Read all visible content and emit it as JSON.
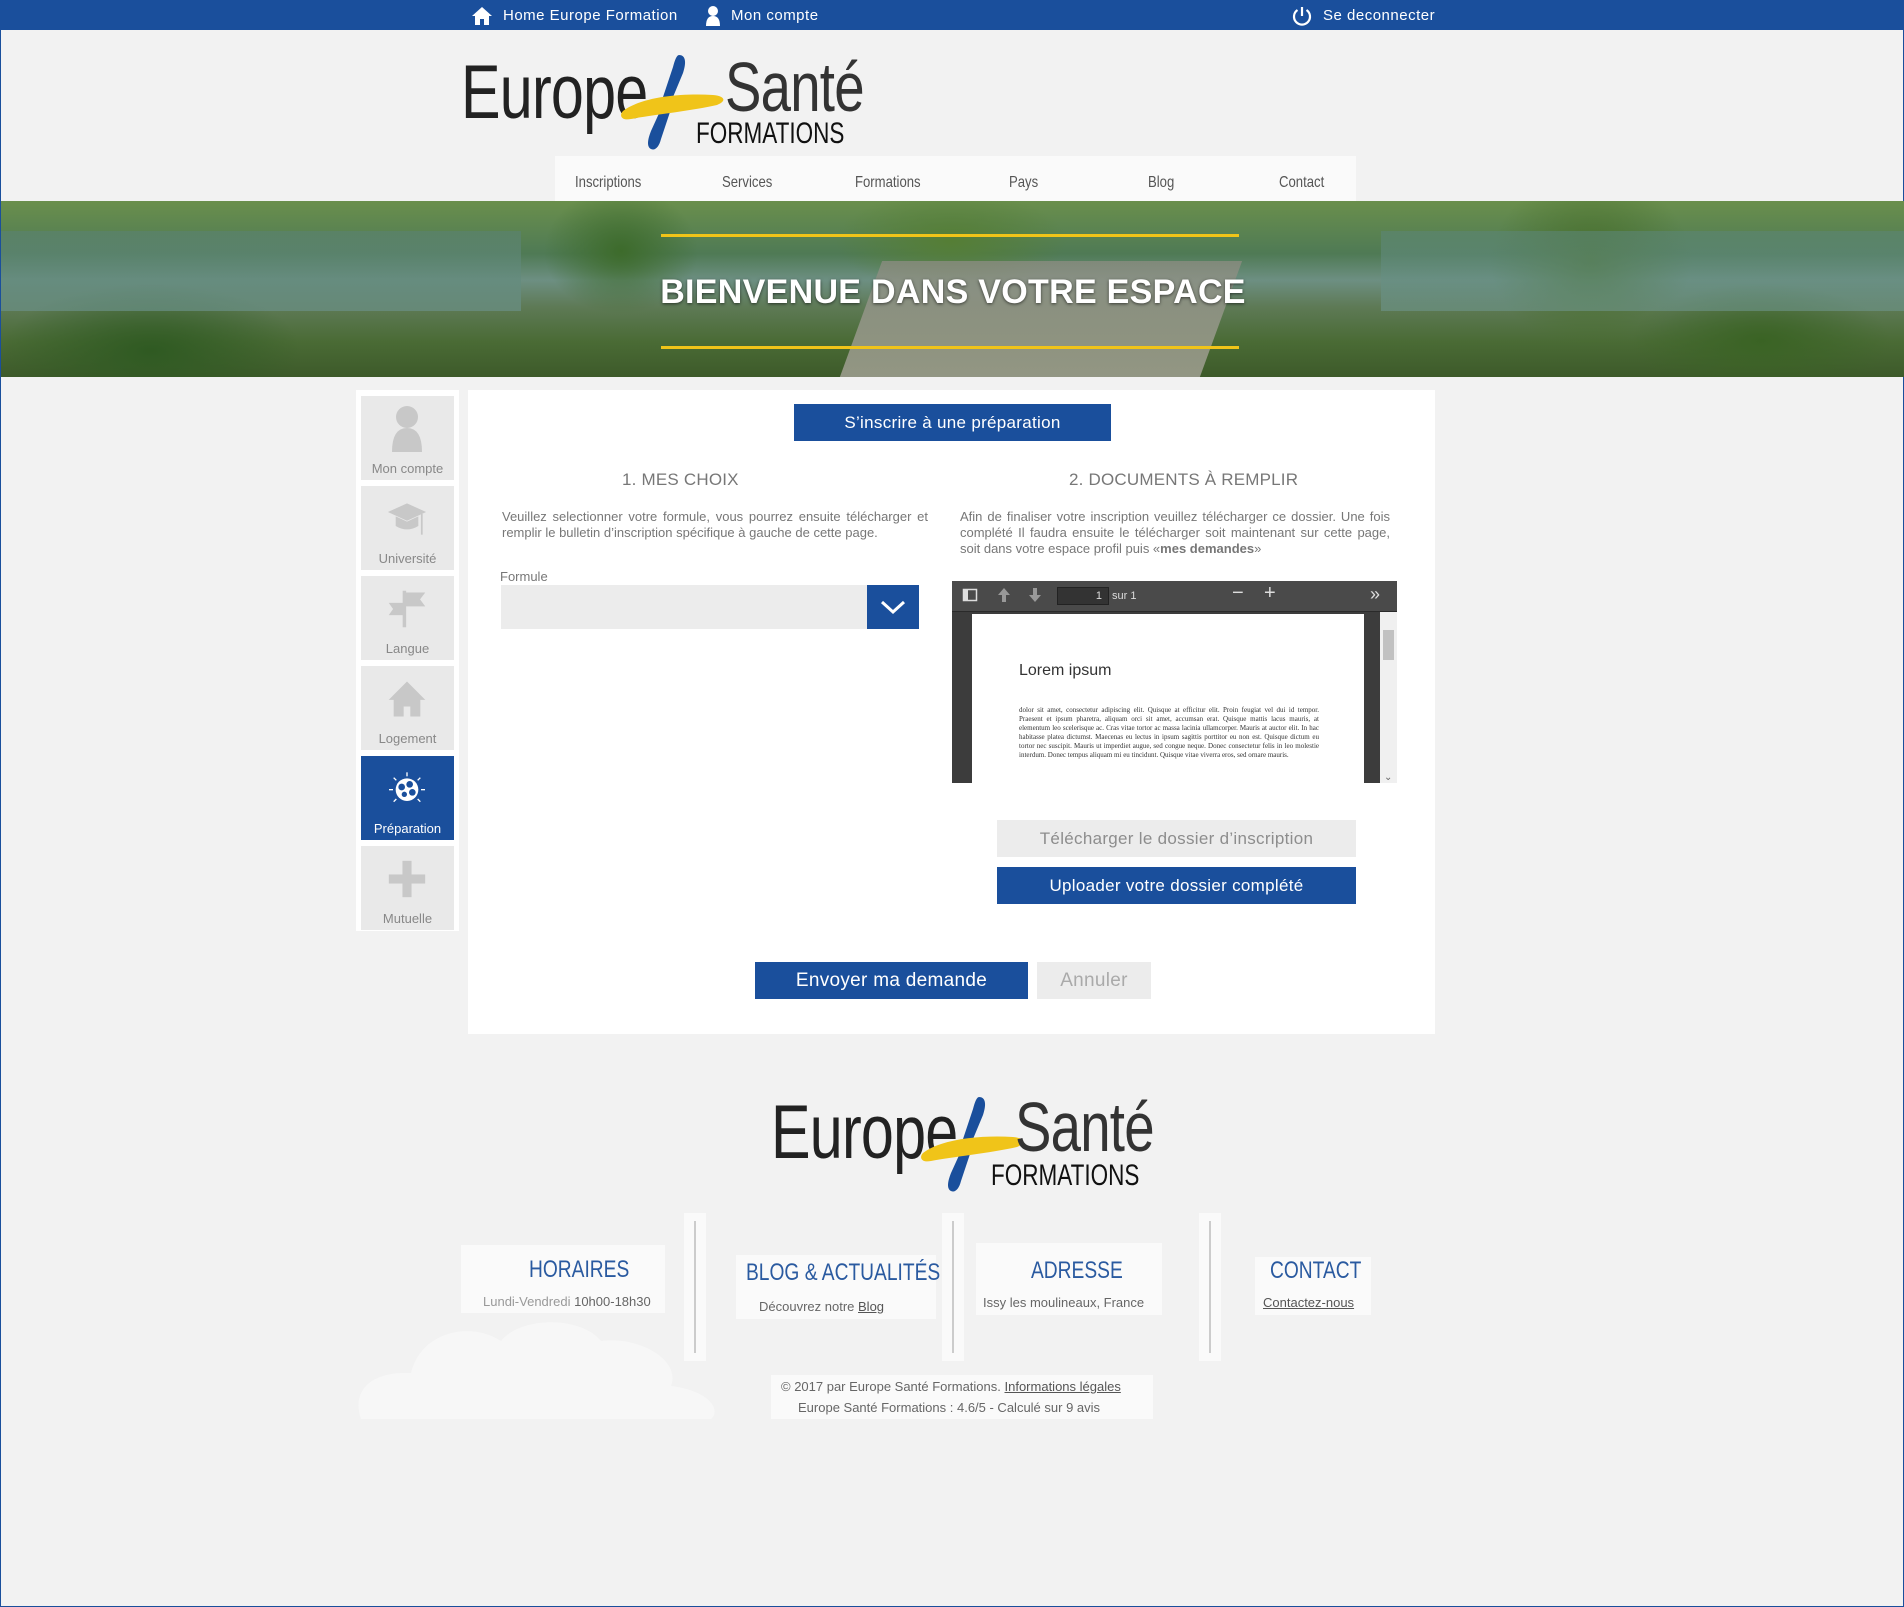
{
  "topbar": {
    "home_label": "Home Europe Formation",
    "account_label": "Mon compte",
    "logout_label": "Se deconnecter"
  },
  "logo": {
    "word1": "Europe",
    "word2": "Santé",
    "word3": "FORMATIONS"
  },
  "nav": {
    "items": [
      "Inscriptions",
      "Services",
      "Formations",
      "Pays",
      "Blog",
      "Contact"
    ]
  },
  "hero": {
    "title": "BIENVENUE DANS VOTRE ESPACE"
  },
  "sidebar": {
    "items": [
      {
        "label": "Mon compte",
        "icon": "user-icon"
      },
      {
        "label": "Université",
        "icon": "graduation-cap-icon"
      },
      {
        "label": "Langue",
        "icon": "flags-icon"
      },
      {
        "label": "Logement",
        "icon": "house-icon"
      },
      {
        "label": "Préparation",
        "icon": "brain-icon"
      },
      {
        "label": "Mutuelle",
        "icon": "plus-icon"
      }
    ],
    "active_label": "Préparation"
  },
  "main": {
    "header_button": "S’inscrire à une préparation",
    "choices": {
      "title": "1. MES CHOIX",
      "text": "Veuillez selectionner votre formule, vous pourrez ensuite télécharger et remplir le bulletin d’inscription spécifique à gauche de cette page.",
      "formule_label": "Formule",
      "formule_value": ""
    },
    "documents": {
      "title": "2. DOCUMENTS À REMPLIR",
      "text_before": "Afin de finaliser votre inscription veuillez télécharger ce dossier. Une fois complété Il faudra ensuite le télécharger soit maintenant sur cette page, soit dans votre espace profil puis «",
      "text_bold": "mes demandes",
      "text_after": "»"
    },
    "pdf": {
      "page_number": "1",
      "page_total": "sur 1",
      "doc_title": "Lorem ipsum",
      "doc_body": "dolor sit amet, consectetur adipiscing elit. Quisque at efficitur elit. Proin feugiat vel dui id tempor. Praesent et ipsum pharetra, aliquam orci sit amet, accumsan erat. Quisque mattis lacus mauris, at elementum leo scelerisque ac. Cras vitae tortor ac massa lacinia ullamcorper. Mauris at auctor elit. In hac habitasse platea dictumst. Maecenas eu lectus in ipsum sagittis porttitor eu non est. Quisque dictum eu tortor nec suscipit. Mauris ut imperdiet augue, sed congue neque. Donec consectetur felis in leo molestie interdum. Donec tempus aliquam mi eu tincidunt. Quisque vitae viverra eros, sed ornare mauris."
    },
    "download_button": "Télécharger le dossier d’inscription",
    "upload_button": "Uploader votre dossier complété",
    "submit_button": "Envoyer ma demande",
    "cancel_button": "Annuler"
  },
  "footer": {
    "horaires_title": "HORAIRES",
    "horaires_days": "Lundi-Vendredi",
    "horaires_hours": "10h00-18h30",
    "blog_title": "BLOG & ACTUALITÉS",
    "blog_text": "Découvrez notre",
    "blog_link": "Blog",
    "adresse_title": "ADRESSE",
    "adresse_text": "Issy les moulineaux, France",
    "contact_title": "CONTACT",
    "contact_link": "Contactez-nous",
    "copyright_text": "© 2017 par Europe Santé Formations.",
    "legal_link": "Informations légales",
    "rating_text": "Europe Santé Formations : 4.6/5 - Calculé sur 9 avis"
  },
  "colors": {
    "brand_blue": "#1a4f9c",
    "brand_yellow": "#f0c419",
    "background": "#f2f2f2"
  }
}
